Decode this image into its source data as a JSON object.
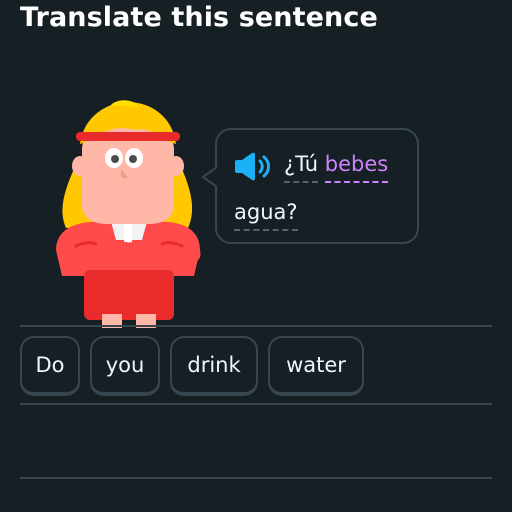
{
  "header": {
    "title": "Translate this sentence"
  },
  "prompt": {
    "speaker_icon": "speaker-icon",
    "accent_color": "#1cb0f6",
    "new_word_color": "#ce82ff",
    "words": [
      "¿Tú",
      "bebes",
      "agua?"
    ]
  },
  "answer": {
    "tiles": [
      "Do",
      "you",
      "drink",
      "water"
    ]
  },
  "colors": {
    "background": "#151f24",
    "border": "#37464f",
    "text": "#f1f7fb"
  }
}
